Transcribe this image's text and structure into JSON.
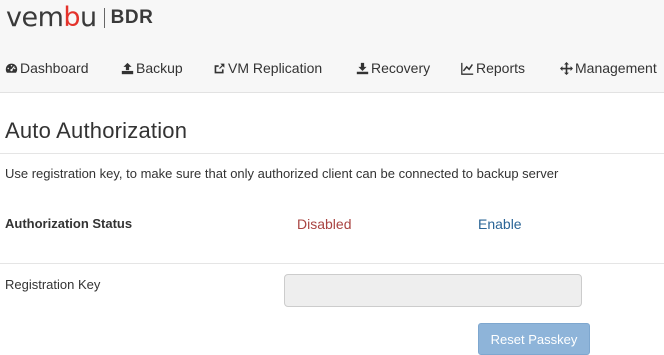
{
  "brand": {
    "wordmark_start": "vem",
    "wordmark_accent": "b",
    "wordmark_end": "u",
    "product": "BDR",
    "accent_color": "#e4322b"
  },
  "nav": {
    "items": [
      {
        "label": "Dashboard",
        "icon": "dashboard-icon"
      },
      {
        "label": "Backup",
        "icon": "upload-icon"
      },
      {
        "label": "VM Replication",
        "icon": "share-icon"
      },
      {
        "label": "Recovery",
        "icon": "download-icon"
      },
      {
        "label": "Reports",
        "icon": "line-chart-icon"
      },
      {
        "label": "Management",
        "icon": "move-icon"
      }
    ]
  },
  "page": {
    "title": "Auto Authorization",
    "description": "Use registration key, to make sure that only authorized client can be connected to backup server",
    "status_label": "Authorization Status",
    "status_value": "Disabled",
    "status_color": "#a94442",
    "enable_link": "Enable",
    "link_color": "#2a6496",
    "registration_key_label": "Registration Key",
    "registration_key_value": "",
    "reset_button": "Reset Passkey"
  }
}
